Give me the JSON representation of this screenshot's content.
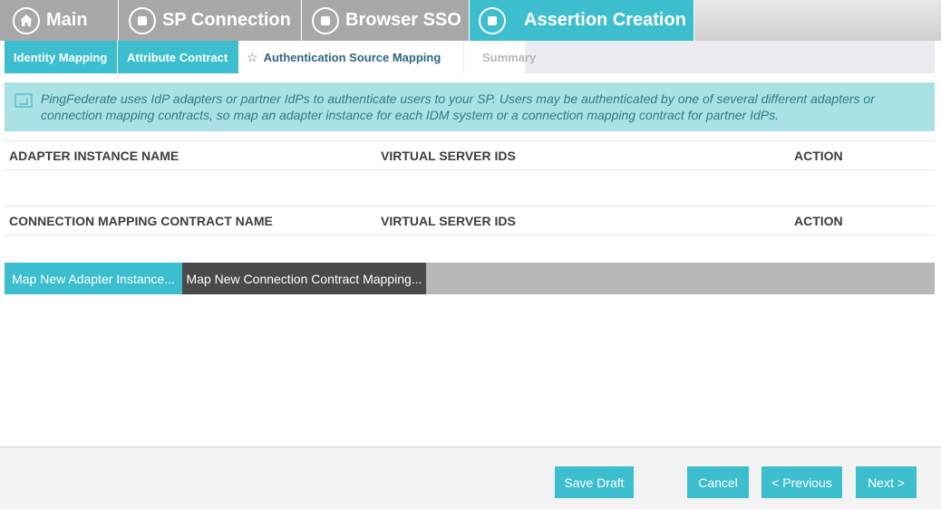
{
  "main_tabs": {
    "main": "Main",
    "sp_connection": "SP Connection",
    "browser_sso": "Browser SSO",
    "assertion_creation": "Assertion Creation"
  },
  "sub_tabs": {
    "identity_mapping": "Identity Mapping",
    "attribute_contract": "Attribute Contract",
    "authentication_source_mapping": "Authentication Source Mapping",
    "summary": "Summary"
  },
  "info_text": "PingFederate uses IdP adapters or partner IdPs to authenticate users to your SP. Users may be authenticated by one of several different adapters or connection mapping contracts, so map an adapter instance for each IDM system or a connection mapping contract for partner IdPs.",
  "adapter_table": {
    "columns": [
      "ADAPTER INSTANCE NAME",
      "VIRTUAL SERVER IDS",
      "ACTION"
    ]
  },
  "connection_table": {
    "columns": [
      "CONNECTION MAPPING CONTRACT NAME",
      "VIRTUAL SERVER IDS",
      "ACTION"
    ]
  },
  "actions": {
    "map_adapter": "Map New Adapter Instance...",
    "map_connection": "Map New Connection Contract Mapping..."
  },
  "footer": {
    "save_draft": "Save Draft",
    "cancel": "Cancel",
    "previous": "< Previous",
    "next": "Next >"
  },
  "colors": {
    "accent": "#3cbecf",
    "dark_button": "#4a4a4a",
    "info_background": "#a9e1e4"
  }
}
